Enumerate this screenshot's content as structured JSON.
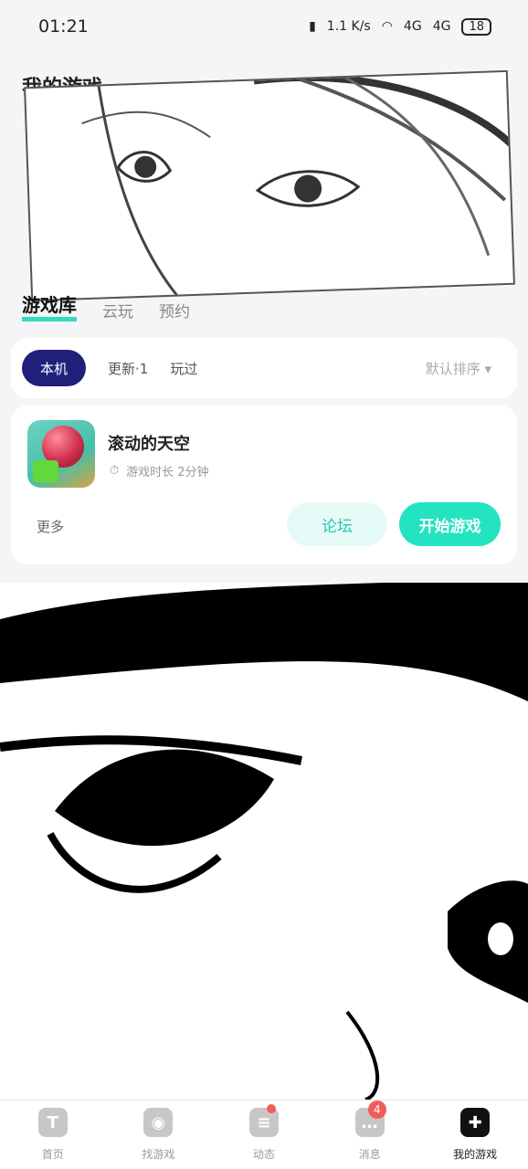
{
  "status_bar": {
    "time": "01:21",
    "net_speed": "1.1 K/s",
    "signal_1": "4G",
    "signal_2": "4G",
    "battery": "18"
  },
  "header": {
    "title": "我的游戏",
    "search_icon": "search-icon",
    "settings_icon": "settings-icon",
    "menu_icon": "menu-icon"
  },
  "top_tabs": [
    "游戏库",
    "云玩",
    "预约"
  ],
  "filters": {
    "active": "本机",
    "tabs": [
      "更新·1",
      "玩过"
    ],
    "sort": "默认排序 ▾"
  },
  "game": {
    "name": "滚动的天空",
    "play_time": "游戏时长 2分钟",
    "more": "更多",
    "forum": "论坛",
    "start": "开始游戏"
  },
  "bottom_nav": [
    {
      "label": "首页"
    },
    {
      "label": "找游戏"
    },
    {
      "label": "动态"
    },
    {
      "label": "消息",
      "badge": "4"
    },
    {
      "label": "我的游戏"
    }
  ]
}
